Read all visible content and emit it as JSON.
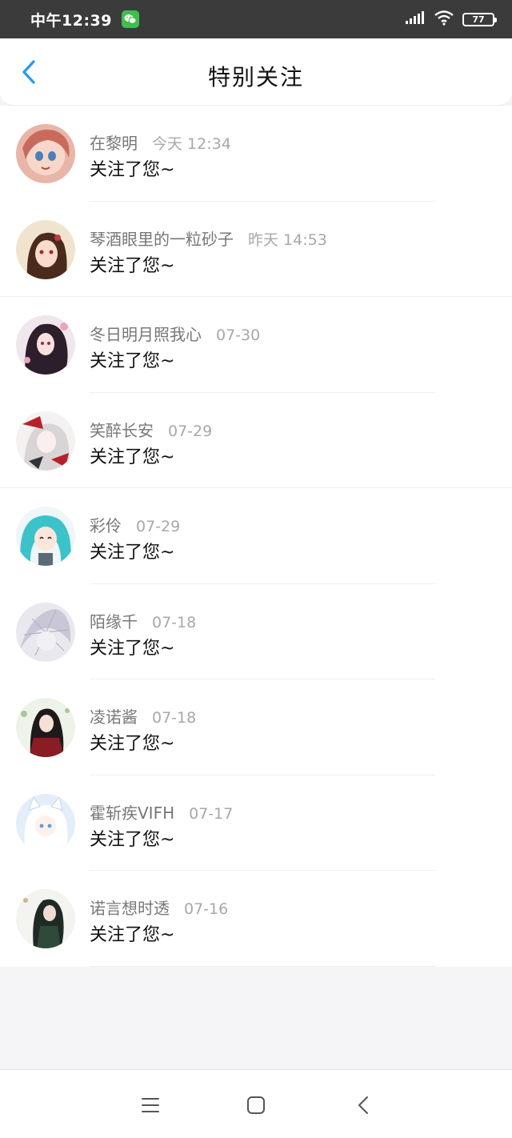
{
  "status_bar": {
    "time": "中午12:39",
    "battery": "77"
  },
  "header": {
    "title": "特别关注"
  },
  "items": [
    {
      "name": "在黎明",
      "time": "今天 12:34",
      "message": "关注了您~"
    },
    {
      "name": "琴酒眼里的一粒砂子",
      "time": "昨天 14:53",
      "message": "关注了您~"
    },
    {
      "name": "冬日明月照我心",
      "time": "07-30",
      "message": "关注了您~"
    },
    {
      "name": "笑醉长安",
      "time": "07-29",
      "message": "关注了您~"
    },
    {
      "name": "彩伶",
      "time": "07-29",
      "message": "关注了您~"
    },
    {
      "name": "陌缘千",
      "time": "07-18",
      "message": "关注了您~"
    },
    {
      "name": "凌诺酱",
      "time": "07-18",
      "message": "关注了您~"
    },
    {
      "name": "霍斩疾VIFH",
      "time": "07-17",
      "message": "关注了您~"
    },
    {
      "name": "诺言想时透",
      "time": "07-16",
      "message": "关注了您~"
    }
  ],
  "colors": {
    "accent": "#2d9bf0",
    "status_bar": "#3b3b3b",
    "wechat": "#3fbf4b"
  }
}
